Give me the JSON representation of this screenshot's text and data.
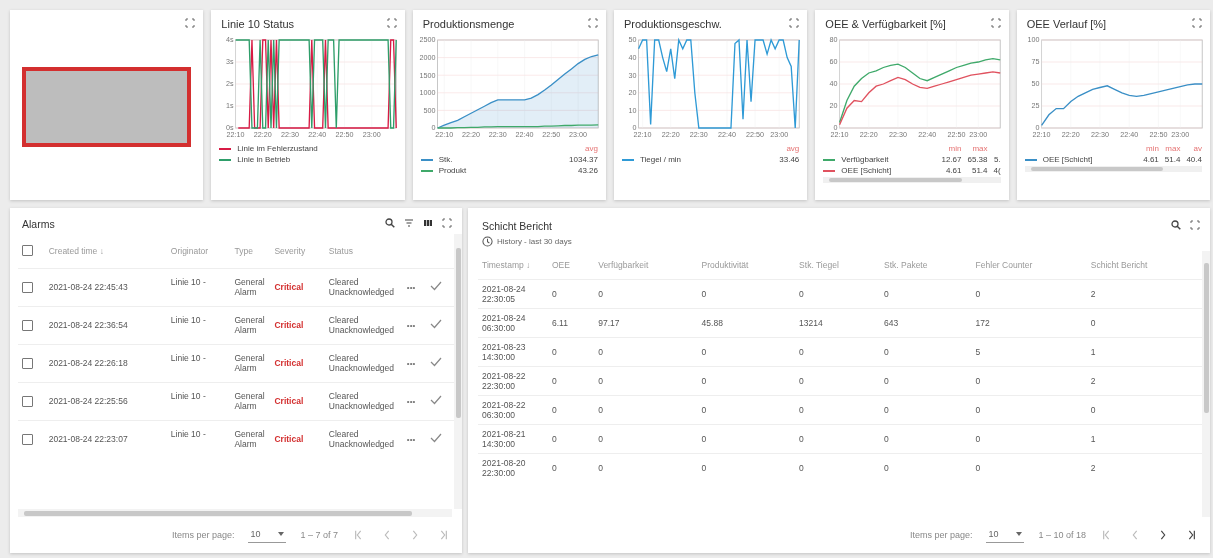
{
  "top_cards": [
    {
      "kind": "indicator",
      "alarm_active": true
    },
    {
      "kind": "chart",
      "title": "Linie 10 Status",
      "chart_data": {
        "type": "line",
        "grid": true,
        "categories": [
          "22:10",
          null,
          null,
          null,
          null,
          null,
          null,
          null,
          null,
          null,
          "22:20",
          null,
          null,
          null,
          null,
          null,
          null,
          null,
          null,
          null,
          "22:30",
          null,
          null,
          null,
          null,
          null,
          null,
          null,
          null,
          null,
          "22:40",
          null,
          null,
          null,
          null,
          null,
          null,
          null,
          null,
          null,
          "22:50",
          null,
          null,
          null,
          null,
          null,
          null,
          null,
          null,
          null,
          "23:00",
          null,
          null,
          null,
          null,
          null,
          null,
          null,
          null,
          null
        ],
        "ylim": [
          0,
          4
        ],
        "yticks": [
          {
            "value": 0,
            "label": "0s"
          },
          {
            "value": 1,
            "label": "1s"
          },
          {
            "value": 2,
            "label": "2s"
          },
          {
            "value": 3,
            "label": "3s"
          },
          {
            "value": 4,
            "label": "4s"
          }
        ],
        "series": [
          {
            "name": "Linie im Fehlerzustand",
            "color": "#d81b45",
            "values": [
              null,
              0,
              0,
              0,
              0,
              0,
              4,
              0,
              0,
              0,
              4,
              4,
              0,
              4,
              0,
              4,
              0,
              0,
              0,
              0,
              0,
              0,
              0,
              0,
              0,
              0,
              0,
              0,
              4,
              0,
              0,
              0,
              0,
              4,
              0,
              0,
              0,
              0,
              0,
              0,
              0,
              0,
              0,
              0,
              0,
              0,
              0,
              0,
              0,
              0,
              0,
              0,
              0,
              0,
              0,
              0,
              0,
              4,
              4,
              0
            ]
          },
          {
            "name": "Linie in Betrieb",
            "color": "#2e9e6a",
            "values": [
              4,
              4,
              4,
              4,
              4,
              4,
              0,
              0,
              0,
              4,
              0,
              0,
              4,
              0,
              4,
              0,
              4,
              4,
              4,
              4,
              4,
              4,
              4,
              4,
              4,
              4,
              4,
              4,
              0,
              4,
              4,
              4,
              4,
              0,
              4,
              4,
              4,
              0,
              4,
              4,
              4,
              4,
              4,
              4,
              4,
              4,
              4,
              4,
              4,
              4,
              4,
              4,
              4,
              4,
              4,
              4,
              4,
              0,
              0,
              4
            ]
          }
        ]
      }
    },
    {
      "kind": "chart",
      "title": "Produktionsmenge",
      "chart_data": {
        "type": "line",
        "grid": true,
        "categories": [
          null,
          "22:10",
          null,
          null,
          null,
          "22:20",
          null,
          null,
          null,
          "22:30",
          null,
          null,
          null,
          "22:40",
          null,
          null,
          null,
          "22:50",
          null,
          null,
          null,
          "23:00",
          null,
          null,
          null
        ],
        "ylim": [
          0,
          2500
        ],
        "yticks": [
          0,
          500,
          1000,
          1500,
          2000,
          2500
        ],
        "series": [
          {
            "name": "Stk.",
            "type": "area",
            "color": "#3a8fc6",
            "values": [
              0,
              80,
              150,
              220,
              320,
              420,
              520,
              620,
              720,
              800,
              800,
              800,
              800,
              800,
              850,
              950,
              1080,
              1220,
              1380,
              1530,
              1680,
              1830,
              1950,
              2030,
              2080
            ]
          },
          {
            "name": "Produkt",
            "type": "line",
            "color": "#3fa96a",
            "values": [
              0,
              0,
              0,
              10,
              10,
              20,
              20,
              30,
              30,
              40,
              40,
              40,
              40,
              40,
              40,
              40,
              50,
              50,
              60,
              70,
              70,
              80,
              80,
              80,
              90
            ]
          }
        ]
      },
      "legend": {
        "headers": [
          "avg"
        ],
        "stats": [
          [
            "1034.37"
          ],
          [
            "43.26"
          ]
        ]
      }
    },
    {
      "kind": "chart",
      "title": "Produktionsgeschw.",
      "chart_data": {
        "type": "line",
        "grid": true,
        "categories": [
          null,
          "22:10",
          null,
          null,
          null,
          null,
          null,
          null,
          "22:20",
          null,
          null,
          null,
          null,
          null,
          null,
          "22:30",
          null,
          null,
          null,
          null,
          null,
          null,
          "22:40",
          null,
          null,
          null,
          null,
          null,
          null,
          "22:50",
          null,
          null,
          null,
          null,
          null,
          "23:00",
          null,
          null,
          null,
          null,
          null
        ],
        "ylim": [
          0,
          50
        ],
        "yticks": [
          0,
          10,
          20,
          30,
          40,
          50
        ],
        "series": [
          {
            "name": "Tiegel / min",
            "color": "#2f9ad6",
            "values": [
              45,
              50,
              50,
              2,
              50,
              50,
              40,
              32,
              45,
              28,
              50,
              45,
              50,
              50,
              20,
              0,
              0,
              0,
              0,
              0,
              0,
              0,
              0,
              0,
              48,
              50,
              5,
              50,
              15,
              50,
              50,
              50,
              42,
              50,
              45,
              50,
              50,
              40,
              35,
              0,
              50
            ]
          }
        ]
      },
      "legend": {
        "headers": [
          "avg"
        ],
        "stats": [
          [
            "33.46"
          ]
        ]
      }
    },
    {
      "kind": "chart",
      "title": "OEE & Verfügbarkeit [%]",
      "chart_data": {
        "type": "line",
        "grid": true,
        "categories": [
          "22:10",
          null,
          null,
          null,
          "22:20",
          null,
          null,
          null,
          "22:30",
          null,
          null,
          null,
          "22:40",
          null,
          null,
          null,
          "22:50",
          null,
          null,
          "23:00",
          null,
          null,
          null
        ],
        "ylim": [
          0,
          80
        ],
        "yticks": [
          0,
          20,
          40,
          60,
          80
        ],
        "series": [
          {
            "name": "Verfügbarkeit",
            "color": "#3fa96a",
            "values": [
              5,
              25,
              38,
              45,
              50,
              52,
              55,
              57,
              58,
              55,
              50,
              45,
              43,
              46,
              49,
              52,
              55,
              57,
              59,
              60,
              62,
              63,
              62
            ]
          },
          {
            "name": "OEE [Schicht]",
            "color": "#e0525f",
            "values": [
              3,
              18,
              25,
              24,
              32,
              38,
              40,
              43,
              46,
              44,
              40,
              37,
              36,
              38,
              40,
              42,
              44,
              46,
              48,
              49,
              50,
              51,
              50
            ]
          }
        ]
      },
      "legend": {
        "headers": [
          "min",
          "max"
        ],
        "stats": [
          [
            "12.67",
            "65.38",
            "5."
          ],
          [
            "4.61",
            "51.4",
            "4("
          ]
        ]
      }
    },
    {
      "kind": "chart",
      "title": "OEE Verlauf [%]",
      "chart_data": {
        "type": "line",
        "grid": true,
        "categories": [
          "22:10",
          null,
          null,
          null,
          "22:20",
          null,
          null,
          null,
          "22:30",
          null,
          null,
          null,
          "22:40",
          null,
          null,
          null,
          "22:50",
          null,
          null,
          "23:00",
          null,
          null,
          null
        ],
        "ylim": [
          0,
          100
        ],
        "yticks": [
          0,
          25,
          50,
          75,
          100
        ],
        "series": [
          {
            "name": "OEE [Schicht]",
            "color": "#3a8fc6",
            "values": [
              3,
              15,
              22,
              22,
              30,
              36,
              40,
              44,
              46,
              48,
              44,
              40,
              37,
              36,
              37,
              39,
              41,
              43,
              45,
              47,
              49,
              50,
              50
            ]
          }
        ]
      },
      "legend": {
        "headers": [
          "min",
          "max",
          "av"
        ],
        "stats": [
          [
            "4.61",
            "51.4",
            "40.4"
          ]
        ]
      }
    }
  ],
  "alarms": {
    "title": "Alarms",
    "all_checked": false,
    "columns": [
      "Created time ↓",
      "Originator",
      "Type",
      "Severity",
      "Status"
    ],
    "rows": [
      {
        "created": "2021-08-24 22:45:43",
        "originator": "Linie 10 -",
        "type": "General Alarm",
        "severity": "Critical",
        "status": "Cleared Unacknowledged",
        "checked": false
      },
      {
        "created": "2021-08-24 22:36:54",
        "originator": "Linie 10 -",
        "type": "General Alarm",
        "severity": "Critical",
        "status": "Cleared Unacknowledged",
        "checked": false
      },
      {
        "created": "2021-08-24 22:26:18",
        "originator": "Linie 10 -",
        "type": "General Alarm",
        "severity": "Critical",
        "status": "Cleared Unacknowledged",
        "checked": false
      },
      {
        "created": "2021-08-24 22:25:56",
        "originator": "Linie 10 -",
        "type": "General Alarm",
        "severity": "Critical",
        "status": "Cleared Unacknowledged",
        "checked": false
      },
      {
        "created": "2021-08-24 22:23:07",
        "originator": "Linie 10 -",
        "type": "General Alarm",
        "severity": "Critical",
        "status": "Cleared Unacknowledged",
        "checked": false
      }
    ],
    "more_label": "•••",
    "paging": {
      "label": "Items per page:",
      "per_page": "10",
      "range": "1 – 7 of 7",
      "prev_enabled": false,
      "next_enabled": false
    }
  },
  "report": {
    "title": "Schicht Bericht",
    "subtitle": "History - last 30 days",
    "columns": [
      "Timestamp ↓",
      "OEE",
      "Verfügbarkeit",
      "Produktivität",
      "Stk. Tiegel",
      "Stk. Pakete",
      "Fehler Counter",
      "Schicht Bericht"
    ],
    "rows": [
      [
        "2021-08-24 22:30:05",
        "0",
        "0",
        "0",
        "0",
        "0",
        "0",
        "2"
      ],
      [
        "2021-08-24 06:30:00",
        "6.11",
        "97.17",
        "45.88",
        "13214",
        "643",
        "172",
        "0"
      ],
      [
        "2021-08-23 14:30:00",
        "0",
        "0",
        "0",
        "0",
        "0",
        "5",
        "1"
      ],
      [
        "2021-08-22 22:30:00",
        "0",
        "0",
        "0",
        "0",
        "0",
        "0",
        "2"
      ],
      [
        "2021-08-22 06:30:00",
        "0",
        "0",
        "0",
        "0",
        "0",
        "0",
        "0"
      ],
      [
        "2021-08-21 14:30:00",
        "0",
        "0",
        "0",
        "0",
        "0",
        "0",
        "1"
      ],
      [
        "2021-08-20 22:30:00",
        "0",
        "0",
        "0",
        "0",
        "0",
        "0",
        "2"
      ]
    ],
    "paging": {
      "label": "Items per page:",
      "per_page": "10",
      "range": "1 – 10 of 18",
      "prev_enabled": false,
      "next_enabled": true
    }
  }
}
